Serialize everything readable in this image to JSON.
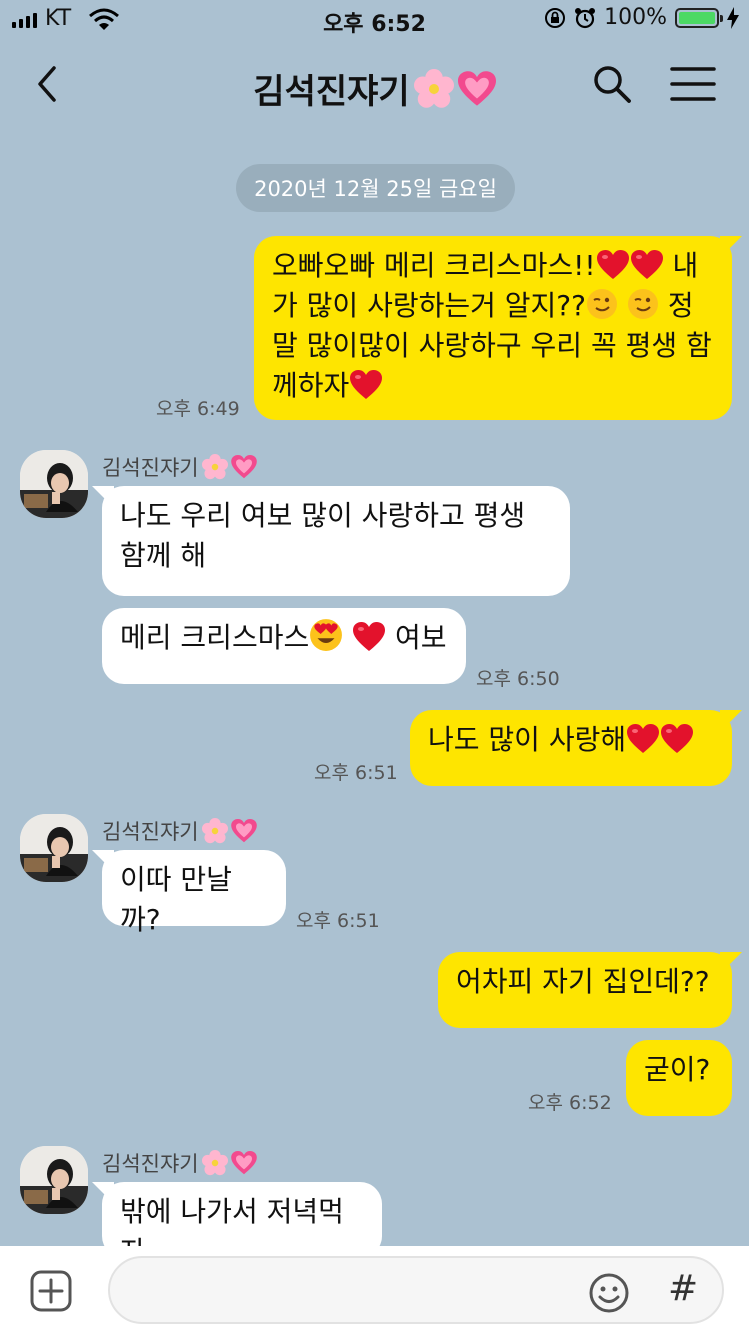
{
  "status_bar": {
    "carrier": "KT",
    "time": "오후 6:52",
    "battery": "100%"
  },
  "header": {
    "title": "김석진쟈기"
  },
  "date_divider": "2020년 12월 25일 금요일",
  "contact_name": "김석진쟈기",
  "messages": {
    "m1": {
      "text": "오빠오빠 메리 크리스마스!!",
      "t2": " 내가 많이 사랑하는거 알지??",
      "t3": " 정말 많이많이 사랑하구 우리 꼭 평생 함께하자",
      "time": "오후 6:49"
    },
    "m2": {
      "text": "나도 우리 여보 많이 사랑하고 평생 함께 해"
    },
    "m3": {
      "text": "메리 크리스마스",
      "t2": " 여보",
      "time": "오후 6:50"
    },
    "m4": {
      "text": "나도 많이 사랑해",
      "time": "오후 6:51"
    },
    "m5": {
      "text": "이따 만날까?",
      "time": "오후 6:51"
    },
    "m6": {
      "text": "어차피 자기 집인데??"
    },
    "m7": {
      "text": "굳이?",
      "time": "오후 6:52"
    },
    "m8": {
      "text": "밖에 나가서 저녁먹자"
    }
  },
  "input": {
    "placeholder": ""
  },
  "colors": {
    "background": "#abc1d1",
    "my_bubble": "#fee500",
    "their_bubble": "#ffffff"
  },
  "icons": [
    "back-icon",
    "search-icon",
    "menu-icon",
    "plus-icon",
    "emoji-icon",
    "hash-icon",
    "heart-emoji",
    "flower-emoji",
    "pink-heart-emoji",
    "wink-emoji",
    "heart-eyes-emoji"
  ]
}
